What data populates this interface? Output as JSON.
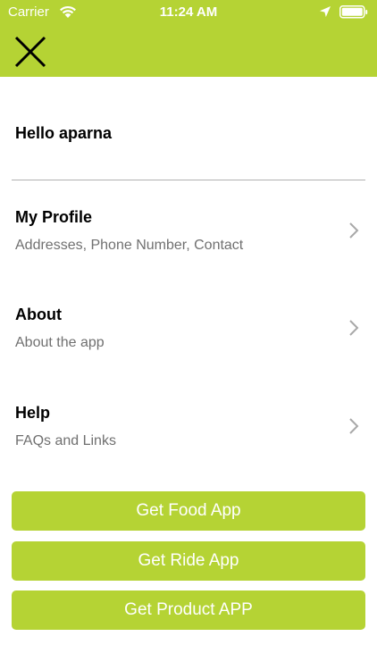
{
  "status_bar": {
    "carrier": "Carrier",
    "time": "11:24 AM"
  },
  "header": {
    "close_icon": "close-icon",
    "background_color": "#b5d334"
  },
  "greeting": "Hello aparna",
  "menu": {
    "items": [
      {
        "title": "My Profile",
        "subtitle": "Addresses, Phone Number, Contact"
      },
      {
        "title": "About",
        "subtitle": "About the app"
      },
      {
        "title": "Help",
        "subtitle": "FAQs and Links"
      }
    ]
  },
  "buttons": {
    "food": "Get Food App",
    "ride": "Get Ride App",
    "product": "Get Product APP"
  },
  "colors": {
    "accent": "#b5d334",
    "subtitle": "#707070",
    "divider": "#b0b0b0"
  }
}
